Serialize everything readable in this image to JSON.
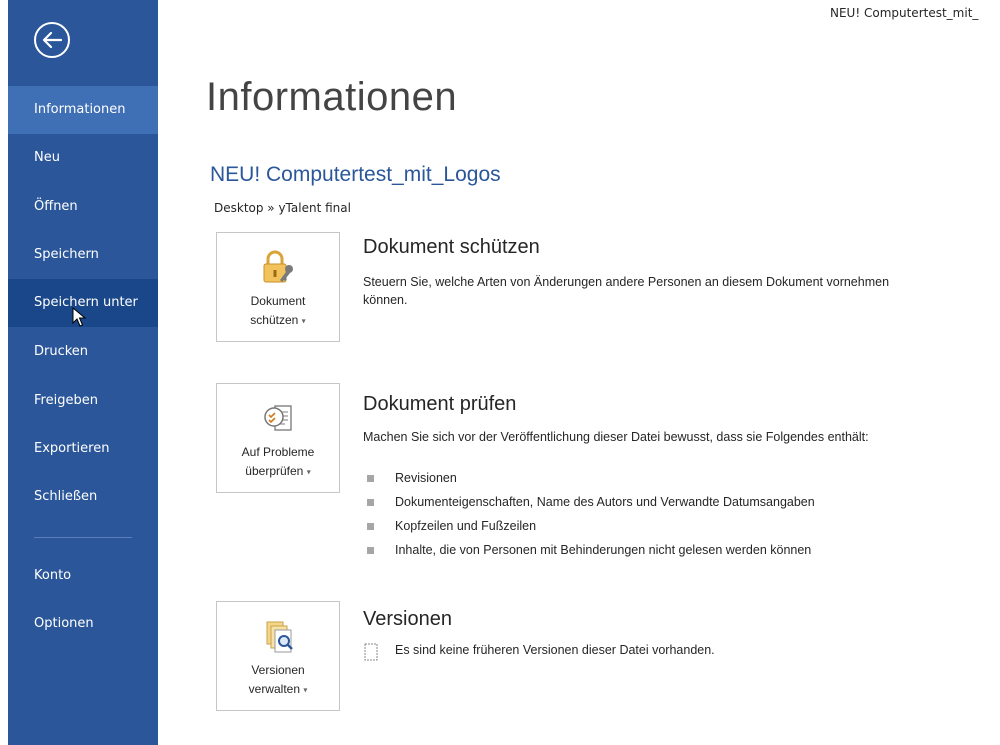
{
  "window": {
    "doc_name_title": "NEU! Computertest_mit_"
  },
  "sidebar": {
    "items": [
      {
        "id": "informationen",
        "label": "Informationen"
      },
      {
        "id": "neu",
        "label": "Neu"
      },
      {
        "id": "oeffnen",
        "label": "Öffnen"
      },
      {
        "id": "speichern",
        "label": "Speichern"
      },
      {
        "id": "speichern-unter",
        "label": "Speichern unter"
      },
      {
        "id": "drucken",
        "label": "Drucken"
      },
      {
        "id": "freigeben",
        "label": "Freigeben"
      },
      {
        "id": "exportieren",
        "label": "Exportieren"
      },
      {
        "id": "schliessen",
        "label": "Schließen"
      },
      {
        "id": "konto",
        "label": "Konto"
      },
      {
        "id": "optionen",
        "label": "Optionen"
      }
    ],
    "active_item": "Informationen",
    "hovered_item": "Speichern unter"
  },
  "main": {
    "title": "Informationen",
    "document_title": "NEU! Computertest_mit_Logos",
    "breadcrumb": "Desktop » yTalent final",
    "sections": {
      "protect": {
        "button_line1": "Dokument",
        "button_line2": "schützen",
        "heading": "Dokument schützen",
        "description": "Steuern Sie, welche Arten von Änderungen andere Personen an diesem Dokument vornehmen können."
      },
      "inspect": {
        "button_line1": "Auf Probleme",
        "button_line2": "überprüfen",
        "heading": "Dokument prüfen",
        "description": "Machen Sie sich vor der Veröffentlichung dieser Datei bewusst, dass sie Folgendes enthält:",
        "bullets": [
          "Revisionen",
          "Dokumenteigenschaften, Name des Autors und Verwandte Datumsangaben",
          "Kopfzeilen und Fußzeilen",
          "Inhalte, die von Personen mit Behinderungen nicht gelesen werden können"
        ]
      },
      "versions": {
        "button_line1": "Versionen",
        "button_line2": "verwalten",
        "heading": "Versionen",
        "info": "Es sind keine früheren Versionen dieser Datei vorhanden."
      }
    }
  },
  "colors": {
    "sidebar": "#2b579a",
    "active": "#3f6fb5",
    "accent_title": "#2b579a"
  },
  "icons": [
    "back-arrow-icon",
    "lock-key-icon",
    "inspect-checklist-icon",
    "versions-magnifier-icon",
    "document-icon",
    "mouse-cursor-icon"
  ]
}
